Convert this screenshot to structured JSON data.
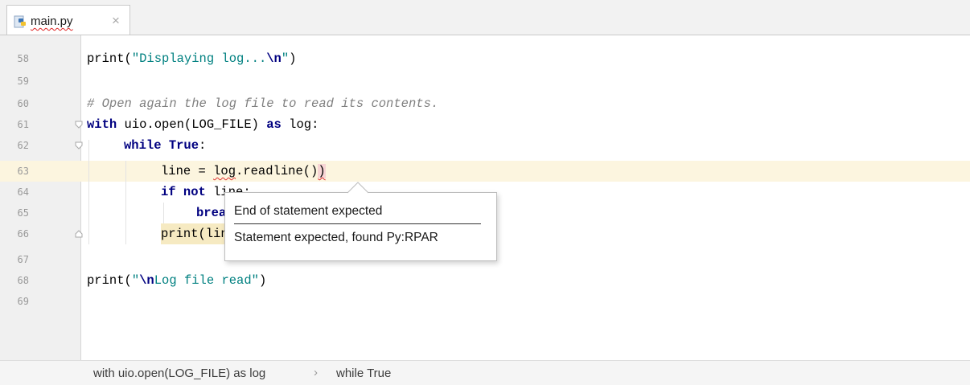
{
  "tab": {
    "filename": "main.py",
    "close_glyph": "×",
    "icon": "python-file-icon"
  },
  "editor": {
    "current_line": 63,
    "lines": [
      {
        "num": "58",
        "code": "print(\"Displaying log...\\n\")"
      },
      {
        "num": "59",
        "code": ""
      },
      {
        "num": "60",
        "code": "# Open again the log file to read its contents."
      },
      {
        "num": "61",
        "code": "with uio.open(LOG_FILE) as log:"
      },
      {
        "num": "62",
        "code": "while True:"
      },
      {
        "num": "63",
        "code": "line = log.readline())"
      },
      {
        "num": "64",
        "code": "if not line:"
      },
      {
        "num": "65",
        "code": "break"
      },
      {
        "num": "66",
        "code": "print(line)"
      },
      {
        "num": "67",
        "code": ""
      },
      {
        "num": "68",
        "code": "print(\"\\nLog file read\")"
      },
      {
        "num": "69",
        "code": ""
      }
    ]
  },
  "tooltip": {
    "title": "End of statement expected",
    "detail": "Statement expected, found Py:RPAR"
  },
  "breadcrumb": {
    "items": [
      "with uio.open(LOG_FILE) as log",
      "while True"
    ],
    "separator": "›"
  },
  "colors": {
    "keyword": "#000080",
    "string": "#008080",
    "comment": "#808080",
    "error": "#e03333",
    "caret_row": "#fcf5df"
  }
}
